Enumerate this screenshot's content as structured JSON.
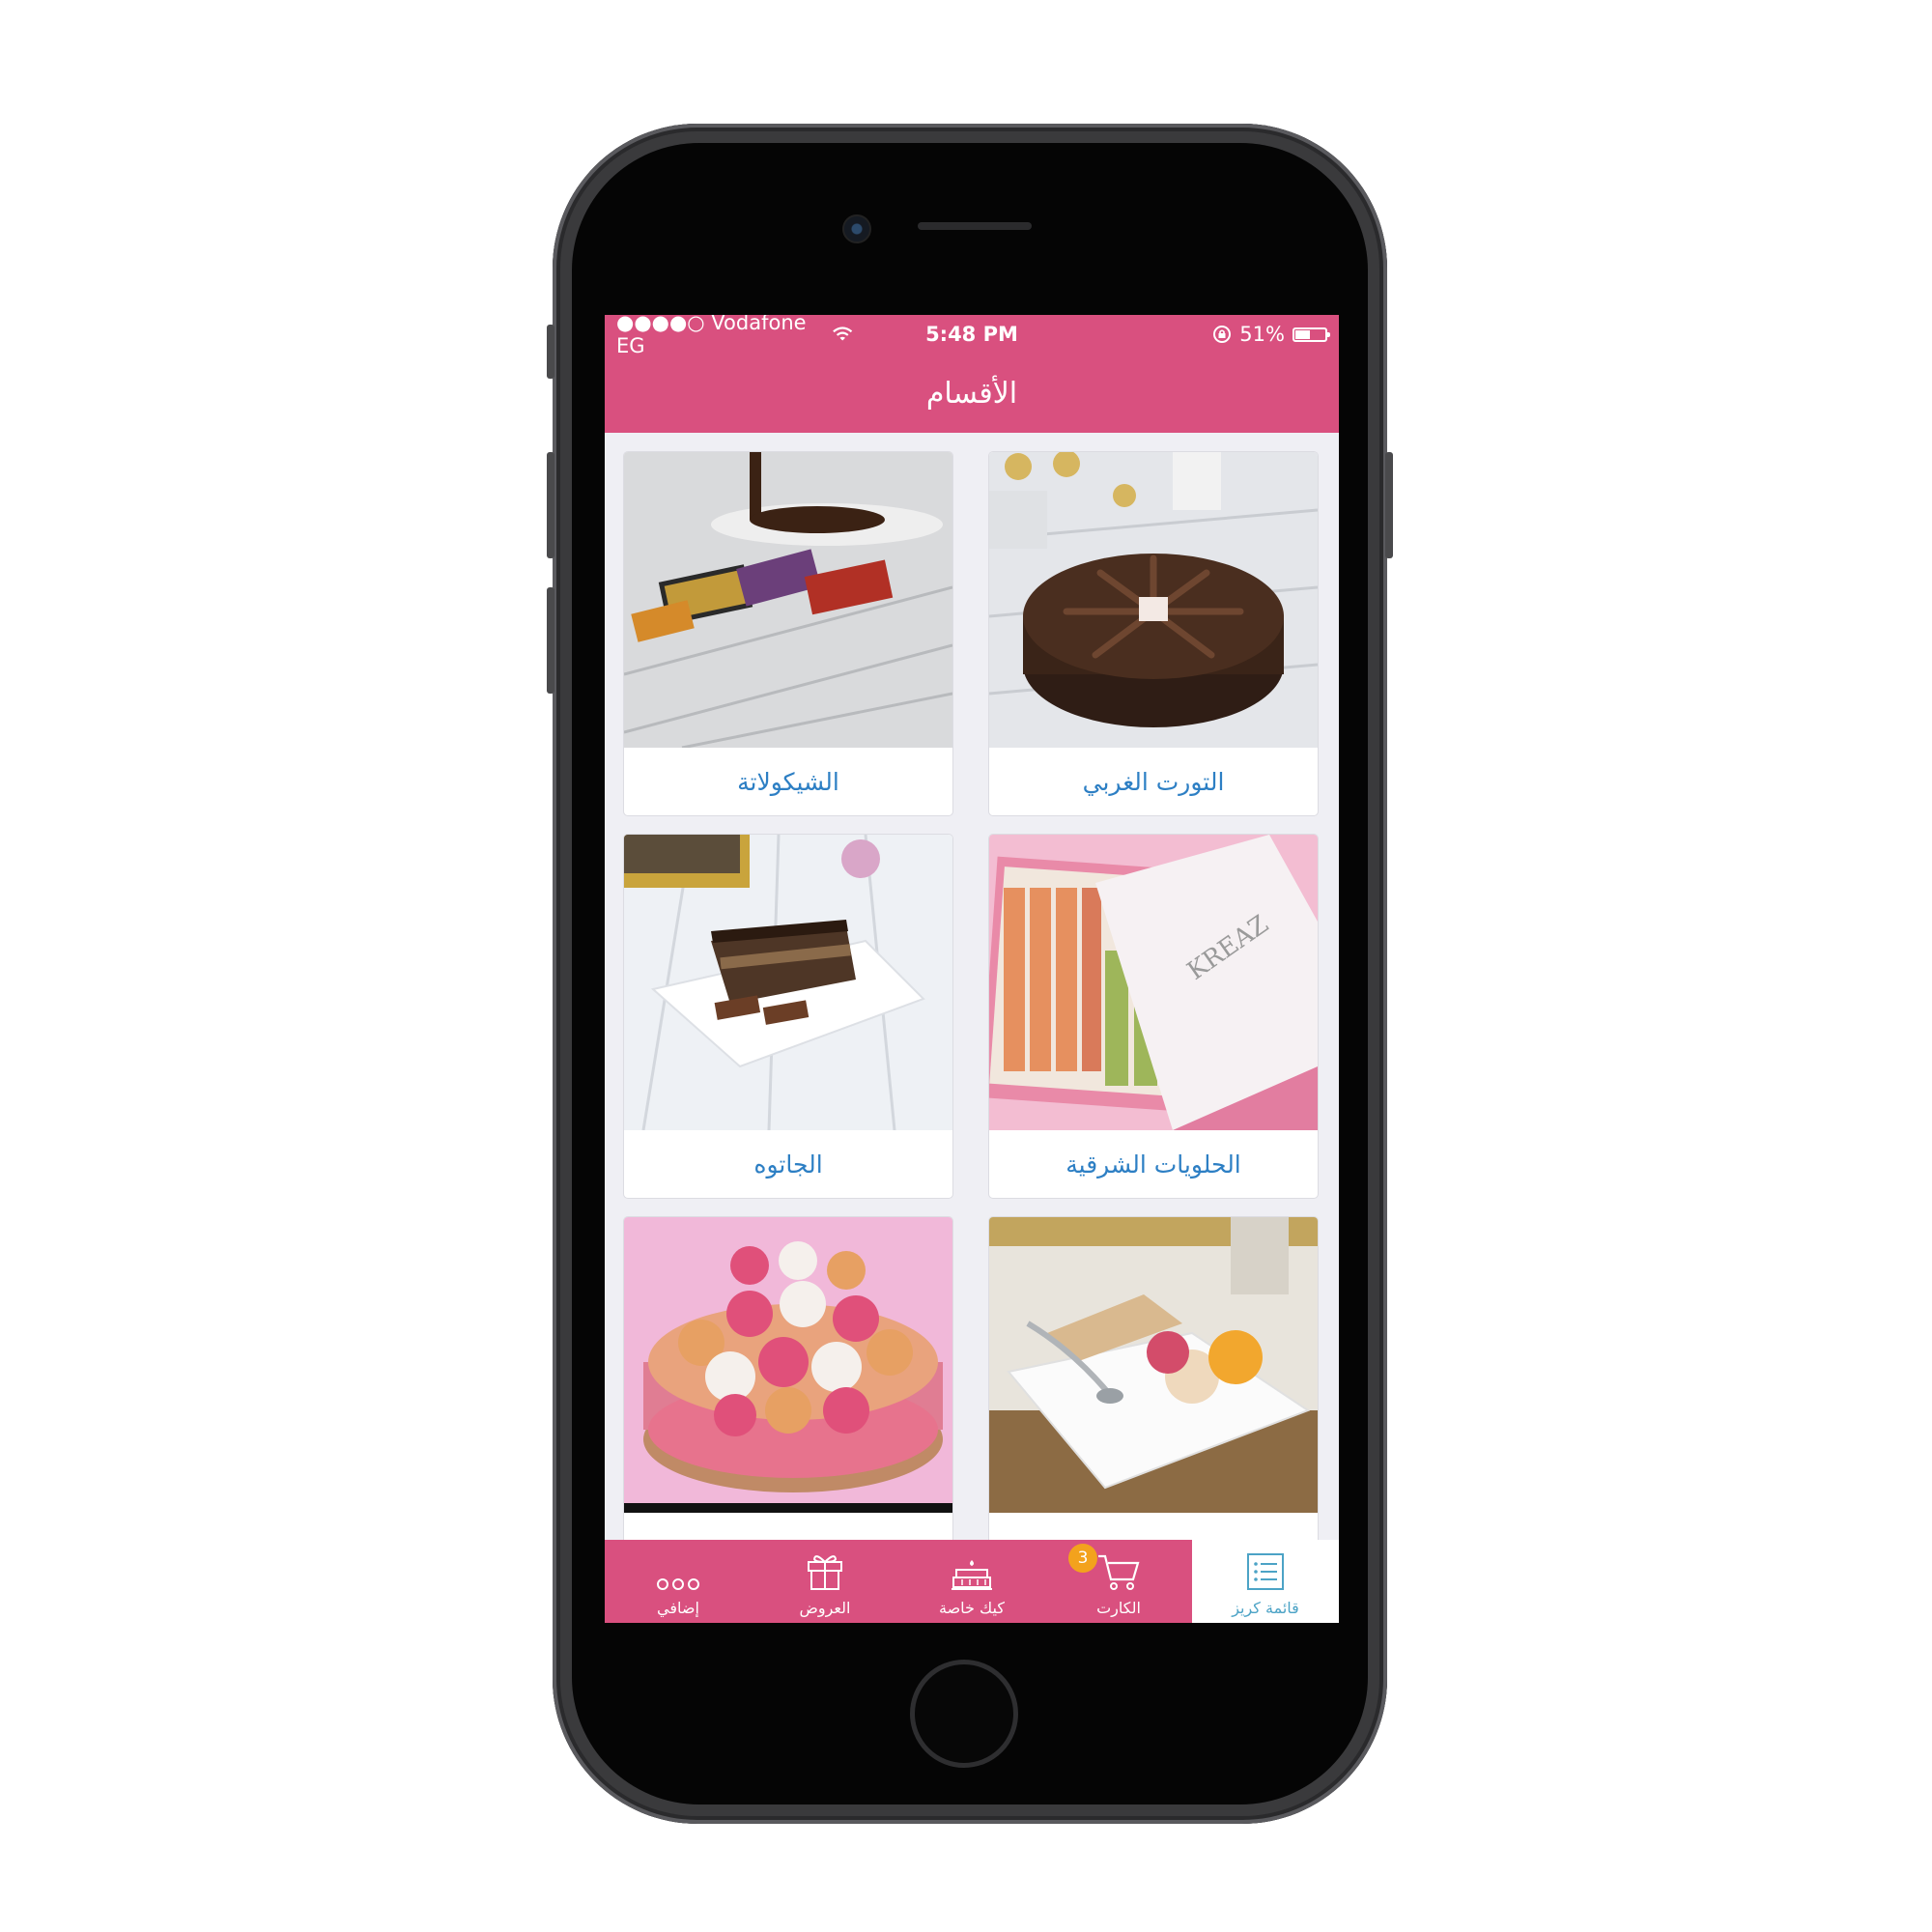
{
  "status_bar": {
    "carrier": "●●●●○ Vodafone EG",
    "time": "5:48 PM",
    "battery": "51%",
    "battery_level": 0.51
  },
  "header": {
    "title": "الأقسام"
  },
  "categories": [
    {
      "label": "التورت الغربي",
      "image": "chocolate-cake"
    },
    {
      "label": "الشيكولاتة",
      "image": "chocolate-bars"
    },
    {
      "label": "الحلويات الشرقية",
      "image": "oriental-sweets-box"
    },
    {
      "label": "الجاتوه",
      "image": "gateau-slice"
    },
    {
      "label": "",
      "image": "ice-cream-plate"
    },
    {
      "label": "",
      "image": "ice-cream-cake"
    }
  ],
  "tab_bar": {
    "items": [
      {
        "label": "قائمة كريز",
        "icon": "list-icon",
        "active": true
      },
      {
        "label": "الكارت",
        "icon": "cart-icon",
        "badge": "3"
      },
      {
        "label": "كيك خاصة",
        "icon": "cake-icon"
      },
      {
        "label": "العروض",
        "icon": "gift-icon"
      },
      {
        "label": "إضافي",
        "icon": "more-icon"
      }
    ]
  },
  "colors": {
    "brand": "#d9507f",
    "link": "#2d7fc4",
    "tab_active": "#4ca3c6",
    "badge": "#f3a21d"
  }
}
